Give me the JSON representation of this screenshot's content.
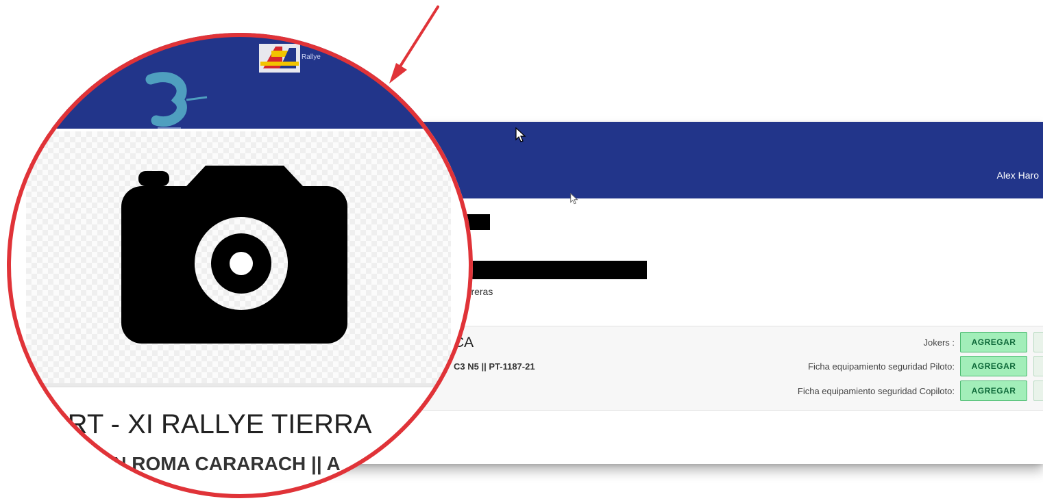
{
  "header": {
    "user_name": "Alex Haro"
  },
  "main": {
    "subtext": "carreras",
    "entry": {
      "title_fragment": "CA",
      "subtitle_fragment": "C3 N5 || PT-1187-21",
      "requirements": [
        {
          "label": "Jokers :",
          "button_label": "AGREGAR"
        },
        {
          "label": "Ficha equipamiento seguridad Piloto:",
          "button_label": "AGREGAR"
        },
        {
          "label": "Ficha equipamiento seguridad Copiloto:",
          "button_label": "AGREGAR"
        }
      ]
    }
  },
  "magnifier": {
    "title": "ERT - XI RALLYE TIERRA",
    "subtitle": "AN ROMA CARARACH || A",
    "photo_icon": "camera-icon"
  },
  "colors": {
    "header_blue": "#22358a",
    "annotation_red": "#e03338",
    "button_green_bg": "#a2eeb9",
    "button_green_border": "#49b86e"
  }
}
